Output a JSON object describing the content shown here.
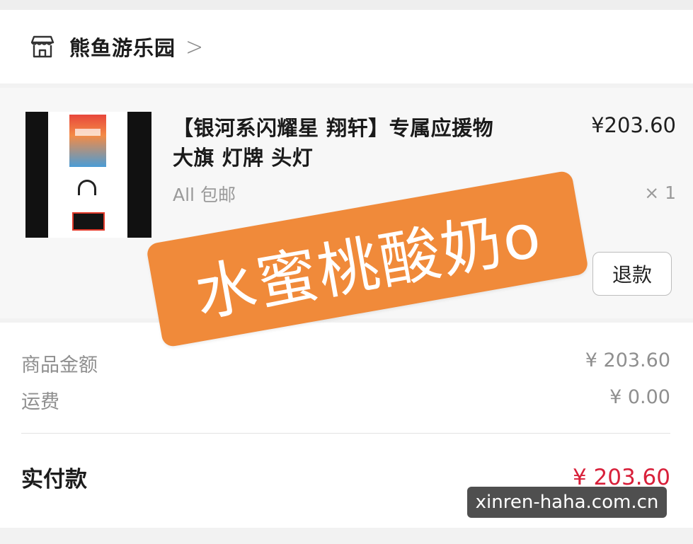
{
  "shop": {
    "name": "熊鱼游乐园",
    "chevron": ">",
    "icon": "store-icon"
  },
  "order_item": {
    "title": "【银河系闪耀星 翔轩】专属应援物 大旗 灯牌 头灯",
    "spec": "All 包邮",
    "price": "¥203.60",
    "quantity": "× 1",
    "refund_label": "退款"
  },
  "summary": {
    "goods_amount_label": "商品金额",
    "goods_amount_value": "¥ 203.60",
    "shipping_label": "运费",
    "shipping_value": "¥ 0.00",
    "paid_label": "实付款",
    "paid_value": "¥ 203.60"
  },
  "overlay": {
    "sticker_text": "水蜜桃酸奶o",
    "watermark": "xinren-haha.com.cn"
  },
  "colors": {
    "sticker": "#f08a3a",
    "paid_value": "#d8203a"
  }
}
